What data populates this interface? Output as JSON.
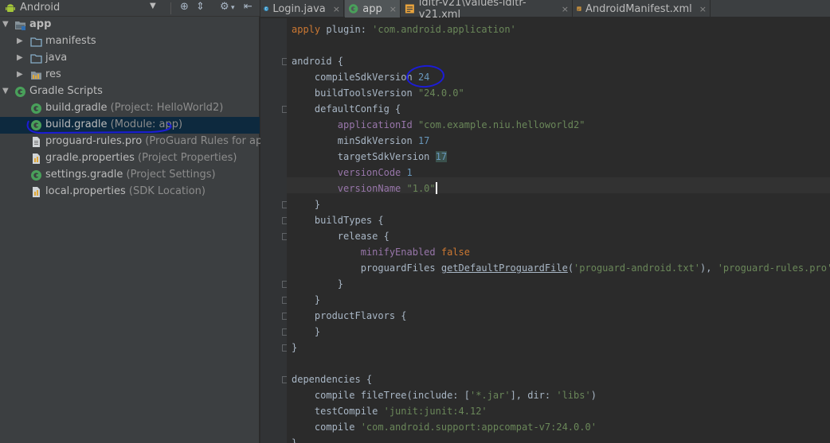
{
  "project_panel": {
    "view_title": "Android",
    "toolbar_icons": [
      "android-icon",
      "dropdown-icon",
      "target-icon",
      "collapse-icon",
      "gear-icon",
      "hide-icon"
    ],
    "tree": {
      "app": "app",
      "manifests": "manifests",
      "java": "java",
      "res": "res",
      "gradle_scripts": "Gradle Scripts",
      "files": [
        {
          "name": "build.gradle",
          "hint": "(Project: HelloWorld2)"
        },
        {
          "name": "build.gradle",
          "hint": "(Module: app)"
        },
        {
          "name": "proguard-rules.pro",
          "hint": "(ProGuard Rules for app)"
        },
        {
          "name": "gradle.properties",
          "hint": "(Project Properties)"
        },
        {
          "name": "settings.gradle",
          "hint": "(Project Settings)"
        },
        {
          "name": "local.properties",
          "hint": "(SDK Location)"
        }
      ]
    }
  },
  "tabs": [
    {
      "label": "Login.java",
      "icon": "java-class-icon",
      "close": "×"
    },
    {
      "label": "app",
      "icon": "gradle-icon",
      "close": "×",
      "active": true
    },
    {
      "label": "ldltr-v21\\values-ldltr-v21.xml",
      "icon": "xml-icon",
      "close": "×"
    },
    {
      "label": "AndroidManifest.xml",
      "icon": "manifest-icon",
      "close": "×"
    }
  ],
  "editor": {
    "s": {
      "apply": "apply",
      "plugin": " plugin: ",
      "plugin_val": "'com.android.application'",
      "android": "android {",
      "compileSdk": "compileSdkVersion ",
      "compileSdk_val": "24",
      "buildTools": "buildToolsVersion ",
      "buildTools_val": "\"24.0.0\"",
      "defaultConfig": "defaultConfig {",
      "appId": "applicationId",
      "appId_val": " \"com.example.niu.helloworld2\"",
      "minSdk": "minSdkVersion ",
      "minSdk_val": "17",
      "targetSdk": "targetSdkVersion ",
      "targetSdk_val": "17",
      "versionCode": "versionCode",
      "versionCode_val": " 1",
      "versionName": "versionName",
      "versionName_val": " \"1.0\"",
      "close": "}",
      "buildTypes": "buildTypes {",
      "release": "release {",
      "minify": "minifyEnabled",
      "minify_val": " false",
      "proguardFiles": "proguardFiles ",
      "getDefault": "getDefaultProguardFile",
      "pg_open": "(",
      "pg_android": "'proguard-android.txt'",
      "pg_mid": "), ",
      "pg_rules": "'proguard-rules.pro'",
      "productFlavors": "productFlavors {",
      "dependencies": "dependencies {",
      "compile": "compile ",
      "fileTree": "fileTree",
      "ft_include": "(include: [",
      "ft_jar": "'*.jar'",
      "ft_dir": "], dir: ",
      "ft_libs": "'libs'",
      "ft_close": ")",
      "testCompile": "testCompile ",
      "junit": "'junit:junit:4.12'",
      "appcompat": "'com.android.support:appcompat-v7:24.0.0'"
    }
  },
  "colors": {
    "keyword": "#cc7832",
    "string": "#6a8759",
    "number": "#6897bb",
    "property": "#9876aa",
    "annotation": "#1c1cd6",
    "selection": "#0d293e"
  }
}
